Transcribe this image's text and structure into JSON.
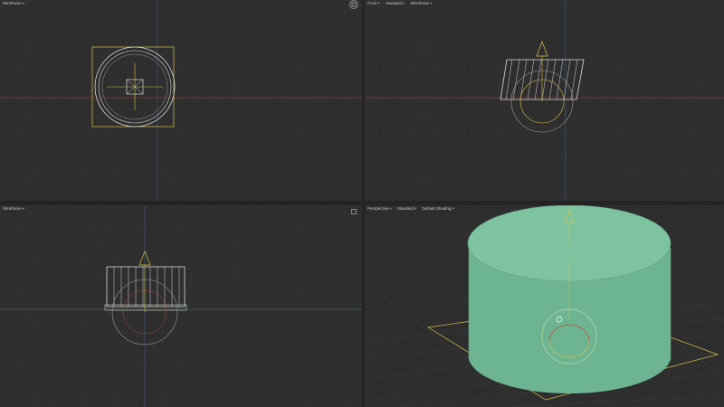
{
  "viewports": {
    "top": {
      "label": "Wireframe",
      "views": []
    },
    "front": {
      "views": [
        "Front",
        "Standard",
        "Wireframe"
      ]
    },
    "left": {
      "label": "Wireframe"
    },
    "perspective": {
      "views": [
        "Perspective",
        "Standard",
        "Default Shading"
      ]
    }
  },
  "colors": {
    "background": "#2e2e2e",
    "grid": "#3a3a3a",
    "axis_red": "#8b3a2e",
    "axis_blue": "#3a4f6e",
    "axis_green": "#3a6a3a",
    "cylinder": "#7ec3a0",
    "cylinder_side": "#6db592",
    "wire_white": "#d8d8d8",
    "gizmo_yellow": "#d6c24a"
  },
  "icons": {
    "viewport_nav": "viewport-nav-icon",
    "maximize": "maximize-viewport-icon"
  }
}
